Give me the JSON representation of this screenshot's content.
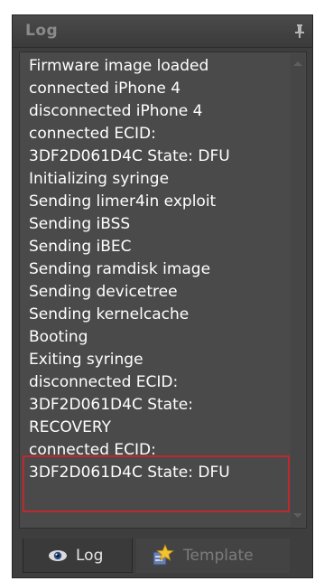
{
  "panel": {
    "title": "Log",
    "pin_icon": "pin-icon"
  },
  "log": {
    "lines": [
      "Firmware image loaded",
      "connected iPhone 4",
      "disconnected iPhone 4",
      "connected ECID:",
      "3DF2D061D4C State: DFU",
      "Initializing syringe",
      "Sending limer4in exploit",
      "Sending iBSS",
      "Sending iBEC",
      "Sending ramdisk image",
      "Sending devicetree",
      "Sending kernelcache",
      "Booting",
      "Exiting syringe",
      "disconnected ECID:",
      "3DF2D061D4C State:",
      "RECOVERY",
      "connected ECID:",
      "3DF2D061D4C State: DFU"
    ],
    "highlight_color": "#c0282f"
  },
  "tabs": [
    {
      "label": "Log",
      "icon": "eye-icon",
      "active": true
    },
    {
      "label": "Template",
      "icon": "template-star-icon",
      "active": false
    }
  ]
}
